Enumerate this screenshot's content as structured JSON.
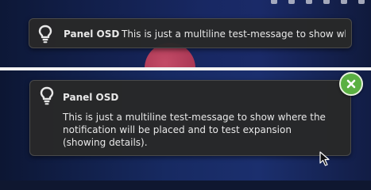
{
  "notification_collapsed": {
    "icon": "lightbulb-icon",
    "title": "Panel OSD",
    "body": "This is just a multiline test-message to show whe..."
  },
  "notification_expanded": {
    "icon": "lightbulb-icon",
    "title": "Panel OSD",
    "body": "This is just a multiline test-message to show where the notification will be placed and to test expansion (showing details).",
    "close_icon": "close-icon"
  },
  "colors": {
    "notification_bg": "#282828",
    "close_button": "#5ab042",
    "text": "#e8e8e8"
  }
}
